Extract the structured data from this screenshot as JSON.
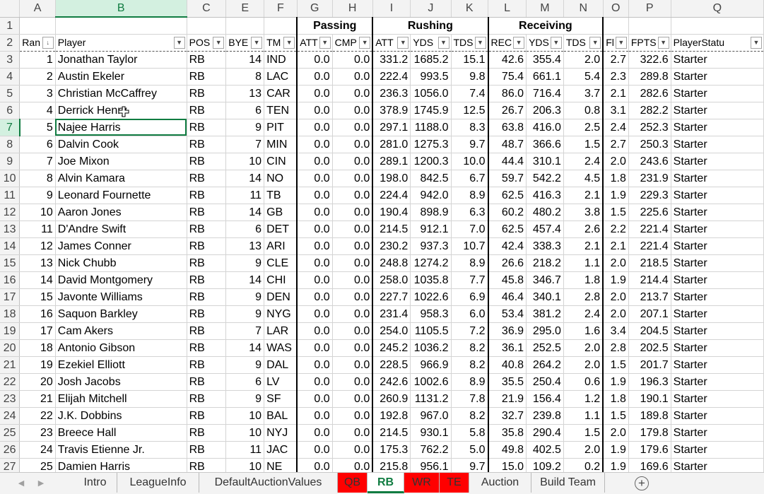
{
  "columns": [
    "A",
    "B",
    "C",
    "E",
    "F",
    "G",
    "H",
    "I",
    "J",
    "K",
    "L",
    "M",
    "N",
    "O",
    "P",
    "Q"
  ],
  "selected_col": "B",
  "selected_row": 7,
  "groups": {
    "passing": "Passing",
    "rushing": "Rushing",
    "receiving": "Receiving"
  },
  "headers": [
    "Ran",
    "Player",
    "POS",
    "BYE",
    "TM",
    "ATT",
    "CMP",
    "ATT",
    "YDS",
    "TDS",
    "REC",
    "YDS",
    "TDS",
    "Fl",
    "FPTS",
    "PlayerStatu"
  ],
  "rows": [
    {
      "n": "3",
      "c": [
        "1",
        "Jonathan Taylor",
        "RB",
        "14",
        "IND",
        "0.0",
        "0.0",
        "331.2",
        "1685.2",
        "15.1",
        "42.6",
        "355.4",
        "2.0",
        "2.7",
        "322.6",
        "Starter"
      ]
    },
    {
      "n": "4",
      "c": [
        "2",
        "Austin Ekeler",
        "RB",
        "8",
        "LAC",
        "0.0",
        "0.0",
        "222.4",
        "993.5",
        "9.8",
        "75.4",
        "661.1",
        "5.4",
        "2.3",
        "289.8",
        "Starter"
      ]
    },
    {
      "n": "5",
      "c": [
        "3",
        "Christian McCaffrey",
        "RB",
        "13",
        "CAR",
        "0.0",
        "0.0",
        "236.3",
        "1056.0",
        "7.4",
        "86.0",
        "716.4",
        "3.7",
        "2.1",
        "282.6",
        "Starter"
      ]
    },
    {
      "n": "6",
      "c": [
        "4",
        "Derrick Henry",
        "RB",
        "6",
        "TEN",
        "0.0",
        "0.0",
        "378.9",
        "1745.9",
        "12.5",
        "26.7",
        "206.3",
        "0.8",
        "3.1",
        "282.2",
        "Starter"
      ]
    },
    {
      "n": "7",
      "c": [
        "5",
        "Najee Harris",
        "RB",
        "9",
        "PIT",
        "0.0",
        "0.0",
        "297.1",
        "1188.0",
        "8.3",
        "63.8",
        "416.0",
        "2.5",
        "2.4",
        "252.3",
        "Starter"
      ]
    },
    {
      "n": "8",
      "c": [
        "6",
        "Dalvin Cook",
        "RB",
        "7",
        "MIN",
        "0.0",
        "0.0",
        "281.0",
        "1275.3",
        "9.7",
        "48.7",
        "366.6",
        "1.5",
        "2.7",
        "250.3",
        "Starter"
      ]
    },
    {
      "n": "9",
      "c": [
        "7",
        "Joe Mixon",
        "RB",
        "10",
        "CIN",
        "0.0",
        "0.0",
        "289.1",
        "1200.3",
        "10.0",
        "44.4",
        "310.1",
        "2.4",
        "2.0",
        "243.6",
        "Starter"
      ]
    },
    {
      "n": "10",
      "c": [
        "8",
        "Alvin Kamara",
        "RB",
        "14",
        "NO",
        "0.0",
        "0.0",
        "198.0",
        "842.5",
        "6.7",
        "59.7",
        "542.2",
        "4.5",
        "1.8",
        "231.9",
        "Starter"
      ]
    },
    {
      "n": "11",
      "c": [
        "9",
        "Leonard Fournette",
        "RB",
        "11",
        "TB",
        "0.0",
        "0.0",
        "224.4",
        "942.0",
        "8.9",
        "62.5",
        "416.3",
        "2.1",
        "1.9",
        "229.3",
        "Starter"
      ]
    },
    {
      "n": "12",
      "c": [
        "10",
        "Aaron Jones",
        "RB",
        "14",
        "GB",
        "0.0",
        "0.0",
        "190.4",
        "898.9",
        "6.3",
        "60.2",
        "480.2",
        "3.8",
        "1.5",
        "225.6",
        "Starter"
      ]
    },
    {
      "n": "13",
      "c": [
        "11",
        "D'Andre Swift",
        "RB",
        "6",
        "DET",
        "0.0",
        "0.0",
        "214.5",
        "912.1",
        "7.0",
        "62.5",
        "457.4",
        "2.6",
        "2.2",
        "221.4",
        "Starter"
      ]
    },
    {
      "n": "14",
      "c": [
        "12",
        "James Conner",
        "RB",
        "13",
        "ARI",
        "0.0",
        "0.0",
        "230.2",
        "937.3",
        "10.7",
        "42.4",
        "338.3",
        "2.1",
        "2.1",
        "221.4",
        "Starter"
      ]
    },
    {
      "n": "15",
      "c": [
        "13",
        "Nick Chubb",
        "RB",
        "9",
        "CLE",
        "0.0",
        "0.0",
        "248.8",
        "1274.2",
        "8.9",
        "26.6",
        "218.2",
        "1.1",
        "2.0",
        "218.5",
        "Starter"
      ]
    },
    {
      "n": "16",
      "c": [
        "14",
        "David Montgomery",
        "RB",
        "14",
        "CHI",
        "0.0",
        "0.0",
        "258.0",
        "1035.8",
        "7.7",
        "45.8",
        "346.7",
        "1.8",
        "1.9",
        "214.4",
        "Starter"
      ]
    },
    {
      "n": "17",
      "c": [
        "15",
        "Javonte Williams",
        "RB",
        "9",
        "DEN",
        "0.0",
        "0.0",
        "227.7",
        "1022.6",
        "6.9",
        "46.4",
        "340.1",
        "2.8",
        "2.0",
        "213.7",
        "Starter"
      ]
    },
    {
      "n": "18",
      "c": [
        "16",
        "Saquon Barkley",
        "RB",
        "9",
        "NYG",
        "0.0",
        "0.0",
        "231.4",
        "958.3",
        "6.0",
        "53.4",
        "381.2",
        "2.4",
        "2.0",
        "207.1",
        "Starter"
      ]
    },
    {
      "n": "19",
      "c": [
        "17",
        "Cam Akers",
        "RB",
        "7",
        "LAR",
        "0.0",
        "0.0",
        "254.0",
        "1105.5",
        "7.2",
        "36.9",
        "295.0",
        "1.6",
        "3.4",
        "204.5",
        "Starter"
      ]
    },
    {
      "n": "20",
      "c": [
        "18",
        "Antonio Gibson",
        "RB",
        "14",
        "WAS",
        "0.0",
        "0.0",
        "245.2",
        "1036.2",
        "8.2",
        "36.1",
        "252.5",
        "2.0",
        "2.8",
        "202.5",
        "Starter"
      ]
    },
    {
      "n": "21",
      "c": [
        "19",
        "Ezekiel Elliott",
        "RB",
        "9",
        "DAL",
        "0.0",
        "0.0",
        "228.5",
        "966.9",
        "8.2",
        "40.8",
        "264.2",
        "2.0",
        "1.5",
        "201.7",
        "Starter"
      ]
    },
    {
      "n": "22",
      "c": [
        "20",
        "Josh Jacobs",
        "RB",
        "6",
        "LV",
        "0.0",
        "0.0",
        "242.6",
        "1002.6",
        "8.9",
        "35.5",
        "250.4",
        "0.6",
        "1.9",
        "196.3",
        "Starter"
      ]
    },
    {
      "n": "23",
      "c": [
        "21",
        "Elijah Mitchell",
        "RB",
        "9",
        "SF",
        "0.0",
        "0.0",
        "260.9",
        "1131.2",
        "7.8",
        "21.9",
        "156.4",
        "1.2",
        "1.8",
        "190.1",
        "Starter"
      ]
    },
    {
      "n": "24",
      "c": [
        "22",
        "J.K. Dobbins",
        "RB",
        "10",
        "BAL",
        "0.0",
        "0.0",
        "192.8",
        "967.0",
        "8.2",
        "32.7",
        "239.8",
        "1.1",
        "1.5",
        "189.8",
        "Starter"
      ]
    },
    {
      "n": "25",
      "c": [
        "23",
        "Breece Hall",
        "RB",
        "10",
        "NYJ",
        "0.0",
        "0.0",
        "214.5",
        "930.1",
        "5.8",
        "35.8",
        "290.4",
        "1.5",
        "2.0",
        "179.8",
        "Starter"
      ]
    },
    {
      "n": "26",
      "c": [
        "24",
        "Travis Etienne Jr.",
        "RB",
        "11",
        "JAC",
        "0.0",
        "0.0",
        "175.3",
        "762.2",
        "5.0",
        "49.8",
        "402.5",
        "2.0",
        "1.9",
        "179.6",
        "Starter"
      ]
    },
    {
      "n": "27",
      "c": [
        "25",
        "Damien Harris",
        "RB",
        "10",
        "NE",
        "0.0",
        "0.0",
        "215.8",
        "956.1",
        "9.7",
        "15.0",
        "109.2",
        "0.2",
        "1.9",
        "169.6",
        "Starter"
      ]
    }
  ],
  "tabs": [
    {
      "label": "Intro",
      "style": "normal"
    },
    {
      "label": "LeagueInfo",
      "style": "normal"
    },
    {
      "label": "DefaultAuctionValues",
      "style": "normal"
    },
    {
      "label": "QB",
      "style": "red"
    },
    {
      "label": "RB",
      "style": "active"
    },
    {
      "label": "WR",
      "style": "red"
    },
    {
      "label": "TE",
      "style": "red"
    },
    {
      "label": "Auction",
      "style": "normal"
    },
    {
      "label": "Build Team",
      "style": "normal"
    }
  ],
  "tab_nav": {
    "prev": "◀",
    "next": "▶"
  },
  "add_sheet_icon": "plus-icon",
  "add_sheet_glyph": "+",
  "filter_glyph": "▼",
  "sort_glyph": "↓"
}
